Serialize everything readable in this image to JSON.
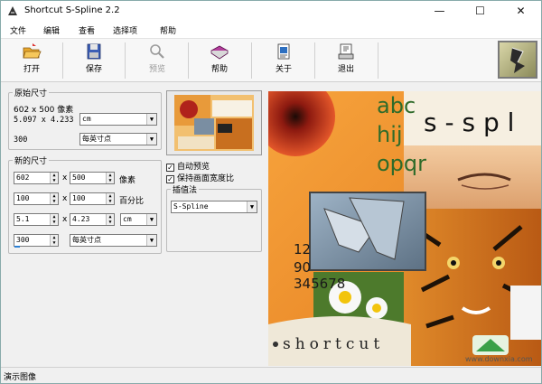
{
  "window": {
    "title": "Shortcut S-Spline 2.2",
    "controls": {
      "minimize": "—",
      "maximize": "☐",
      "close": "✕"
    }
  },
  "menu": [
    "文件",
    "编辑",
    "查看",
    "选择项",
    "帮助"
  ],
  "toolbar": {
    "open": "打开",
    "save": "保存",
    "preview": "预览",
    "help": "帮助",
    "about": "关于",
    "exit": "退出"
  },
  "original": {
    "legend": "原始尺寸",
    "pixels": "602 x 500 像素",
    "size": "5.097 x 4.233",
    "size_unit": "cm",
    "resolution": "300",
    "resolution_unit": "每英寸点"
  },
  "new_size": {
    "legend": "新的尺寸",
    "width_px": "602",
    "height_px": "500",
    "px_unit": "像素",
    "width_pct": "100",
    "height_pct": "100",
    "pct_unit": "百分比",
    "width_cm": "5.1",
    "height_cm": "4.23",
    "cm_unit": "cm",
    "resolution": "300",
    "resolution_unit": "每英寸点",
    "x": "x"
  },
  "options": {
    "auto_preview": "自动预览",
    "keep_aspect": "保持画面宽度比",
    "interp_legend": "插值法",
    "interp_value": "S-Spline"
  },
  "preview_text": {
    "line1": "abc",
    "line2": "hij",
    "line3": "opqr",
    "sspl": "s - s p l",
    "nums1": "12",
    "nums2": "90",
    "nums3": "345678",
    "brand": "shortcut",
    "watermark": "www.downxia.com"
  },
  "status": "演示图像"
}
